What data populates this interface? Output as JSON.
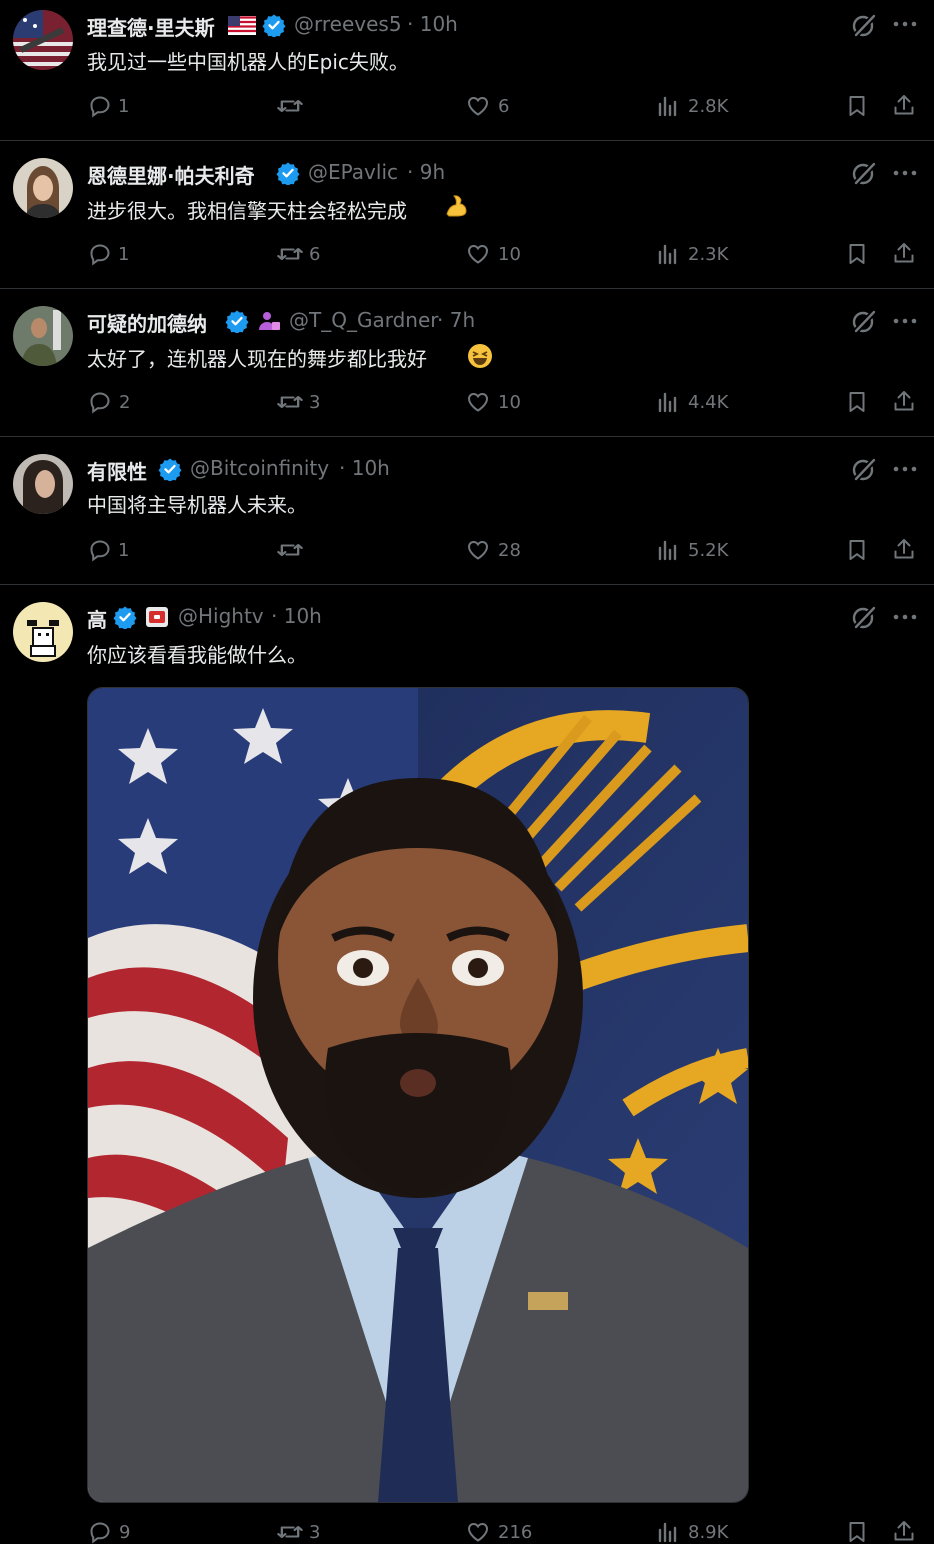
{
  "tweets": [
    {
      "name": "理查德·里夫斯",
      "handle": "@rreeves5",
      "time": "· 10h",
      "text": "我见过一些中国机器人的Epic失败。",
      "replies": "1",
      "retweets": "",
      "likes": "6",
      "views": "2.8K"
    },
    {
      "name": "恩德里娜·帕夫利奇",
      "handle": "@EPavlic",
      "time": "· 9h",
      "text": "进步很大。我相信擎天柱会轻松完成",
      "replies": "1",
      "retweets": "6",
      "likes": "10",
      "views": "2.3K"
    },
    {
      "name": "可疑的加德纳",
      "handle": "@T_Q_Gardner",
      "time": "· 7h",
      "text": "太好了，连机器人现在的舞步都比我好",
      "replies": "2",
      "retweets": "3",
      "likes": "10",
      "views": "4.4K"
    },
    {
      "name": "有限性",
      "handle": "@Bitcoinfinity",
      "time": "· 10h",
      "text": "中国将主导机器人未来。",
      "replies": "1",
      "retweets": "",
      "likes": "28",
      "views": "5.2K"
    },
    {
      "name": "高",
      "handle": "@Hightv",
      "time": "· 10h",
      "text": "你应该看看我能做什么。",
      "replies": "9",
      "retweets": "3",
      "likes": "216",
      "views": "8.9K"
    }
  ],
  "colors": {
    "verified": "#1d9bf0",
    "text": "#e7e9ea",
    "muted": "#71767b",
    "divider": "#2f3336"
  }
}
